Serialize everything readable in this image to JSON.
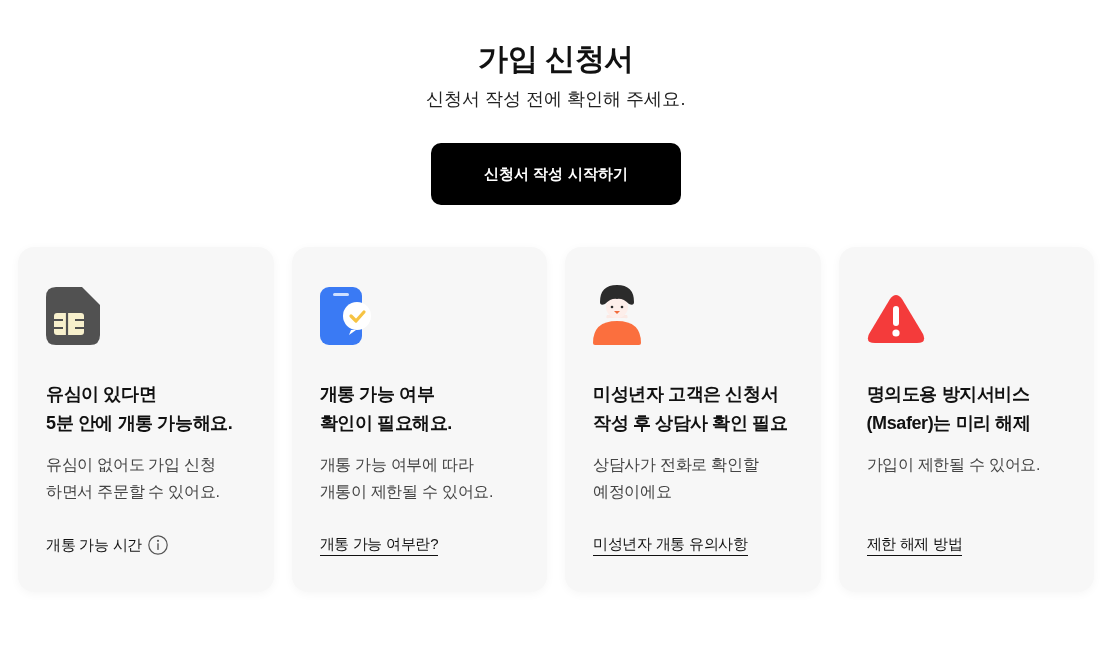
{
  "header": {
    "title": "가입 신청서",
    "subtitle": "신청서 작성 전에 확인해 주세요."
  },
  "start_button": {
    "label": "신청서 작성 시작하기"
  },
  "cards": [
    {
      "heading": "유심이 있다면\n5분 안에 개통 가능해요.",
      "description": "유심이 없어도 가입 신청\n하면서 주문할 수 있어요.",
      "footer": {
        "kind": "info",
        "text": "개통 가능 시간"
      }
    },
    {
      "heading": "개통 가능 여부\n확인이 필요해요.",
      "description": "개통 가능 여부에 따라\n개통이 제한될 수 있어요.",
      "footer": {
        "kind": "link",
        "text": "개통 가능 여부란?"
      }
    },
    {
      "heading": "미성년자 고객은 신청서\n작성 후 상담사 확인 필요",
      "description": "상담사가 전화로 확인할\n예정이에요",
      "footer": {
        "kind": "link",
        "text": "미성년자 개통 유의사항"
      }
    },
    {
      "heading": "명의도용 방지서비스\n(Msafer)는 미리 해제",
      "description": "가입이 제한될 수 있어요.",
      "footer": {
        "kind": "link",
        "text": "제한 해제 방법"
      }
    }
  ]
}
